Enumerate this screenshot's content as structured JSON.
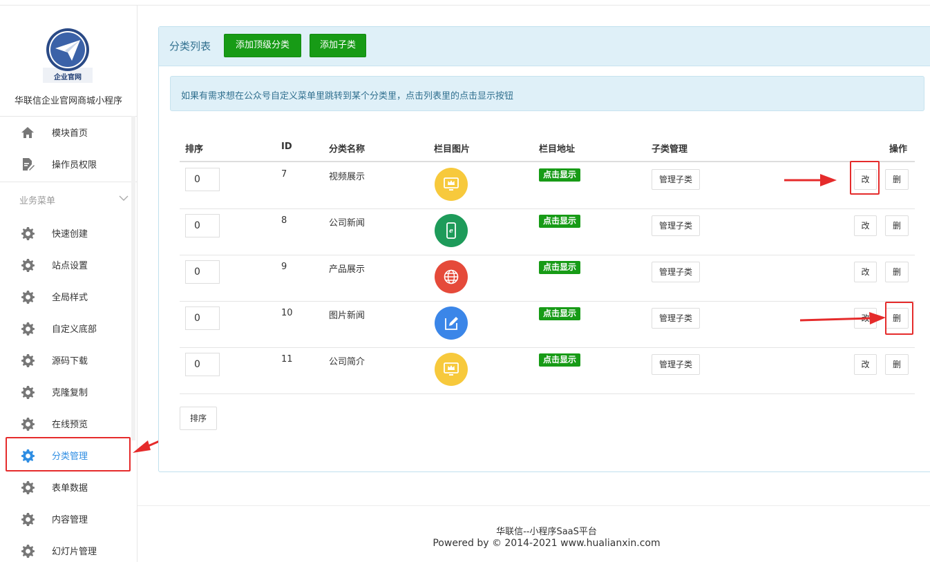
{
  "sidebar": {
    "logo_text": "企业官网",
    "site_name": "华联信企业官网商城小程序",
    "top_items": [
      {
        "label": "模块首页",
        "icon": "home-icon"
      },
      {
        "label": "操作员权限",
        "icon": "document-edit-icon"
      }
    ],
    "section_label": "业务菜单",
    "items": [
      {
        "label": "快速创建",
        "icon": "gear-icon"
      },
      {
        "label": "站点设置",
        "icon": "gear-icon"
      },
      {
        "label": "全局样式",
        "icon": "gear-icon"
      },
      {
        "label": "自定义底部",
        "icon": "gear-icon"
      },
      {
        "label": "源码下载",
        "icon": "gear-icon"
      },
      {
        "label": "克隆复制",
        "icon": "gear-icon"
      },
      {
        "label": "在线预览",
        "icon": "gear-icon"
      },
      {
        "label": "分类管理",
        "icon": "gear-icon",
        "active": true
      },
      {
        "label": "表单数据",
        "icon": "gear-icon"
      },
      {
        "label": "内容管理",
        "icon": "gear-icon"
      },
      {
        "label": "幻灯片管理",
        "icon": "gear-icon"
      }
    ]
  },
  "panel": {
    "title": "分类列表",
    "add_top_label": "添加顶级分类",
    "add_child_label": "添加子类",
    "notice": "如果有需求想在公众号自定义菜单里跳转到某个分类里，点击列表里的点击显示按钮"
  },
  "table": {
    "headers": {
      "sort": "排序",
      "id": "ID",
      "name": "分类名称",
      "image": "栏目图片",
      "address": "栏目地址",
      "children": "子类管理",
      "actions": "操作"
    },
    "rows": [
      {
        "sort": "0",
        "id": "7",
        "name": "视频展示",
        "icon": "monitor-crown-icon",
        "color": "#f7c93c",
        "show_label": "点击显示",
        "manage_label": "管理子类",
        "edit_label": "改",
        "delete_label": "删"
      },
      {
        "sort": "0",
        "id": "8",
        "name": "公司新闻",
        "icon": "phone-e-icon",
        "color": "#1e9b5a",
        "show_label": "点击显示",
        "manage_label": "管理子类",
        "edit_label": "改",
        "delete_label": "删"
      },
      {
        "sort": "0",
        "id": "9",
        "name": "产品展示",
        "icon": "globe-icon",
        "color": "#e54a3a",
        "show_label": "点击显示",
        "manage_label": "管理子类",
        "edit_label": "改",
        "delete_label": "删"
      },
      {
        "sort": "0",
        "id": "10",
        "name": "图片新闻",
        "icon": "edit-pen-icon",
        "color": "#3b86e8",
        "show_label": "点击显示",
        "manage_label": "管理子类",
        "edit_label": "改",
        "delete_label": "删"
      },
      {
        "sort": "0",
        "id": "11",
        "name": "公司简介",
        "icon": "monitor-crown-icon",
        "color": "#f7c93c",
        "show_label": "点击显示",
        "manage_label": "管理子类",
        "edit_label": "改",
        "delete_label": "删"
      }
    ],
    "sort_button_label": "排序"
  },
  "footer": {
    "line1": "华联信--小程序SaaS平台",
    "line2": "Powered by © 2014-2021 www.hualianxin.com"
  },
  "colors": {
    "primary_green": "#179b16",
    "info_bg": "#dff0f8",
    "info_text": "#31708f",
    "active_blue": "#2f8ee3",
    "annotation_red": "#e52b2b"
  }
}
